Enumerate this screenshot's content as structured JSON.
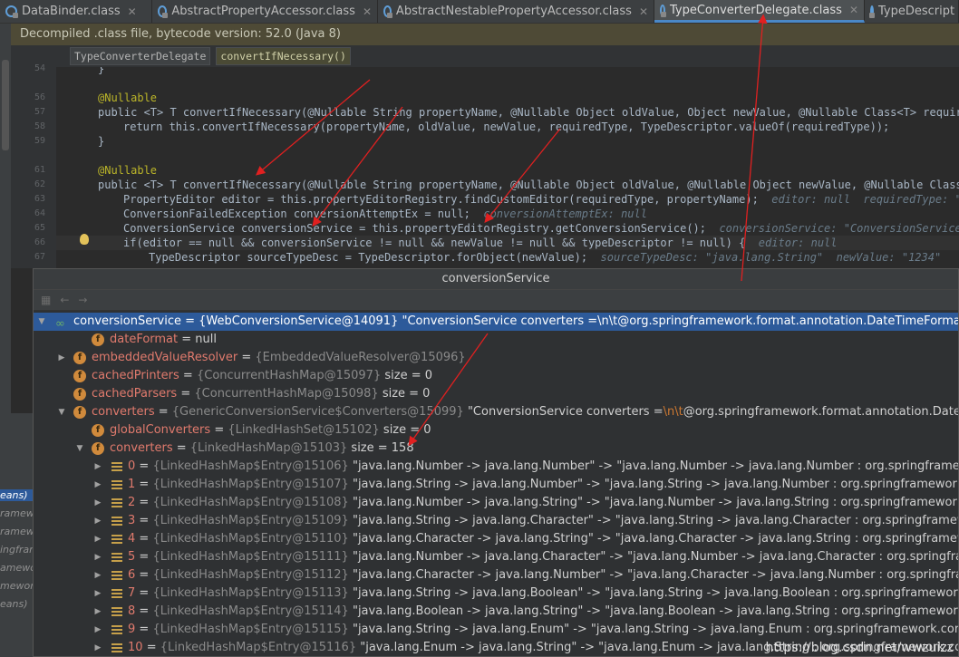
{
  "tabs": [
    {
      "label": "DataBinder.class",
      "active": false
    },
    {
      "label": "AbstractPropertyAccessor.class",
      "active": false
    },
    {
      "label": "AbstractNestablePropertyAccessor.class",
      "active": false
    },
    {
      "label": "TypeConverterDelegate.class",
      "active": true
    },
    {
      "label": "TypeDescript",
      "active": false
    }
  ],
  "banner": "Decompiled .class file, bytecode version: 52.0 (Java 8)",
  "breadcrumb": [
    "TypeConverterDelegate",
    "convertIfNecessary()"
  ],
  "line_numbers": [
    "54",
    "55",
    "56",
    "57",
    "58",
    "59",
    "60",
    "61",
    "62",
    "63",
    "64",
    "65",
    "66",
    "67",
    "68"
  ],
  "code": {
    "l54": "}",
    "l56": "@Nullable",
    "l57": "public <T> T convertIfNecessary(@Nullable String propertyName, @Nullable Object oldValue, Object newValue, @Nullable Class<T> requiredTy",
    "l58": "return this.convertIfNecessary(propertyName, oldValue, newValue, requiredType, TypeDescriptor.valueOf(requiredType));",
    "l59": "}",
    "l61": "@Nullable",
    "l62": "public <T> T convertIfNecessary(@Nullable String propertyName, @Nullable Object oldValue, @Nullable Object newValue, @Nullable Class<T> r",
    "l63": "PropertyEditor editor = this.propertyEditorRegistry.findCustomEditor(requiredType, propertyName);",
    "l63_hint": "editor: null  requiredType: \"clas",
    "l64": "ConversionFailedException conversionAttemptEx = null;",
    "l64_hint": "conversionAttemptEx: null",
    "l65": "ConversionService conversionService = this.propertyEditorRegistry.getConversionService();",
    "l65_hint": "conversionService: \"ConversionService con",
    "l66": "if(editor == null && conversionService != null && newValue != null && typeDescriptor != null) {",
    "l66_hint": "editor: null",
    "l67": "TypeDescriptor sourceTypeDesc = TypeDescriptor.forObject(newValue);",
    "l67_hint": "sourceTypeDesc: \"java.lang.String\"  newValue: \"1234\""
  },
  "popup": {
    "title": "conversionService",
    "root": {
      "name": "conversionService",
      "value": "= {WebConversionService@14091} \"ConversionService converters =\\n\\t@org.springframework.format.annotation.DateTimeFormat java.la"
    },
    "fields": [
      {
        "name": "dateFormat",
        "value": "= null",
        "ref": "",
        "extra": ""
      },
      {
        "name": "embeddedValueResolver",
        "value": "=",
        "ref": "{EmbeddedValueResolver@15096}",
        "extra": ""
      },
      {
        "name": "cachedPrinters",
        "value": "=",
        "ref": "{ConcurrentHashMap@15097}",
        "extra": "size = 0"
      },
      {
        "name": "cachedParsers",
        "value": "=",
        "ref": "{ConcurrentHashMap@15098}",
        "extra": "size = 0"
      }
    ],
    "converters": {
      "name": "converters",
      "value": "=",
      "ref": "{GenericConversionService$Converters@15099}",
      "extra1": "\"ConversionService converters =",
      "extra2": "\\n\\t",
      "extra3": "@org.springframework.format.annotation.DateTimeFor"
    },
    "globalConverters": {
      "name": "globalConverters",
      "value": "=",
      "ref": "{LinkedHashSet@15102}",
      "extra": "size = 0"
    },
    "innerConverters": {
      "name": "converters",
      "value": "=",
      "ref": "{LinkedHashMap@15103}",
      "extra": "size = 158"
    },
    "entries": [
      {
        "idx": "0",
        "ref": "{LinkedHashMap$Entry@15106}",
        "text": "\"java.lang.Number -> java.lang.Number\" -> \"java.lang.Number -> java.lang.Number : org.springframework.core.co"
      },
      {
        "idx": "1",
        "ref": "{LinkedHashMap$Entry@15107}",
        "text": "\"java.lang.String -> java.lang.Number\" -> \"java.lang.String -> java.lang.Number : org.springframework.core.conv"
      },
      {
        "idx": "2",
        "ref": "{LinkedHashMap$Entry@15108}",
        "text": "\"java.lang.Number -> java.lang.String\" -> \"java.lang.Number -> java.lang.String : org.springframework.core.co"
      },
      {
        "idx": "3",
        "ref": "{LinkedHashMap$Entry@15109}",
        "text": "\"java.lang.String -> java.lang.Character\" -> \"java.lang.String -> java.lang.Character : org.springframework.cor"
      },
      {
        "idx": "4",
        "ref": "{LinkedHashMap$Entry@15110}",
        "text": "\"java.lang.Character -> java.lang.String\" -> \"java.lang.Character -> java.lang.String : org.springframework.cor"
      },
      {
        "idx": "5",
        "ref": "{LinkedHashMap$Entry@15111}",
        "text": "\"java.lang.Number -> java.lang.Character\" -> \"java.lang.Number -> java.lang.Character : org.springframework.c"
      },
      {
        "idx": "6",
        "ref": "{LinkedHashMap$Entry@15112}",
        "text": "\"java.lang.Character -> java.lang.Number\" -> \"java.lang.Character -> java.lang.Number : org.springframework.c"
      },
      {
        "idx": "7",
        "ref": "{LinkedHashMap$Entry@15113}",
        "text": "\"java.lang.String -> java.lang.Boolean\" -> \"java.lang.String -> java.lang.Boolean : org.springframework.core.c"
      },
      {
        "idx": "8",
        "ref": "{LinkedHashMap$Entry@15114}",
        "text": "\"java.lang.Boolean -> java.lang.String\" -> \"java.lang.Boolean -> java.lang.String : org.springframework.core.co"
      },
      {
        "idx": "9",
        "ref": "{LinkedHashMap$Entry@15115}",
        "text": "\"java.lang.String -> java.lang.Enum\" -> \"java.lang.String -> java.lang.Enum : org.springframework.core.conver"
      },
      {
        "idx": "10",
        "ref": "{LinkedHashMap$Entry@15116}",
        "text": "\"java.lang.Enum -> java.lang.String\" -> \"java.lang.Enum -> java.lang.String : org.springframework.co"
      }
    ]
  },
  "left_panel": [
    "eans)",
    "ramew",
    "ramew",
    "ingfram",
    "amewor",
    "mewor",
    "eans)"
  ],
  "watermark": "https://blog.csdn.net/wwzuizz"
}
